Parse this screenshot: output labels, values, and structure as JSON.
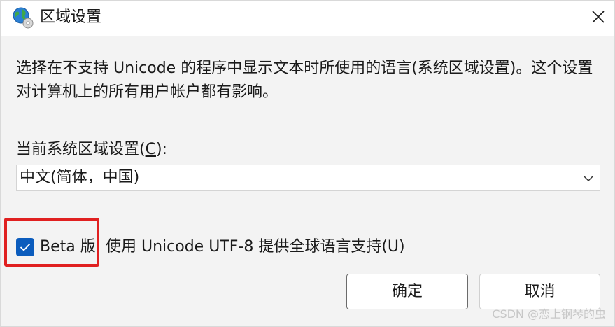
{
  "window": {
    "title": "区域设置",
    "icon": "globe-icon",
    "close_icon": "close-icon"
  },
  "description": "选择在不支持 Unicode 的程序中显示文本时所使用的语言(系统区域设置)。这个设置对计算机上的所有用户帐户都有影响。",
  "locale": {
    "label_prefix": "当前系统区域设置(",
    "label_mnemonic": "C",
    "label_suffix": "):",
    "selected_value": "中文(简体，中国)",
    "chevron_icon": "chevron-down-icon"
  },
  "utf8_option": {
    "checked": true,
    "beta_label": "Beta 版",
    "label": "使用 Unicode UTF-8 提供全球语言支持(U)"
  },
  "buttons": {
    "ok_label": "确定",
    "cancel_label": "取消"
  },
  "watermark": "CSDN @恋上钢琴的虫",
  "colors": {
    "accent": "#0b5cbd",
    "highlight": "#e02020",
    "background": "#f3f3f3"
  }
}
